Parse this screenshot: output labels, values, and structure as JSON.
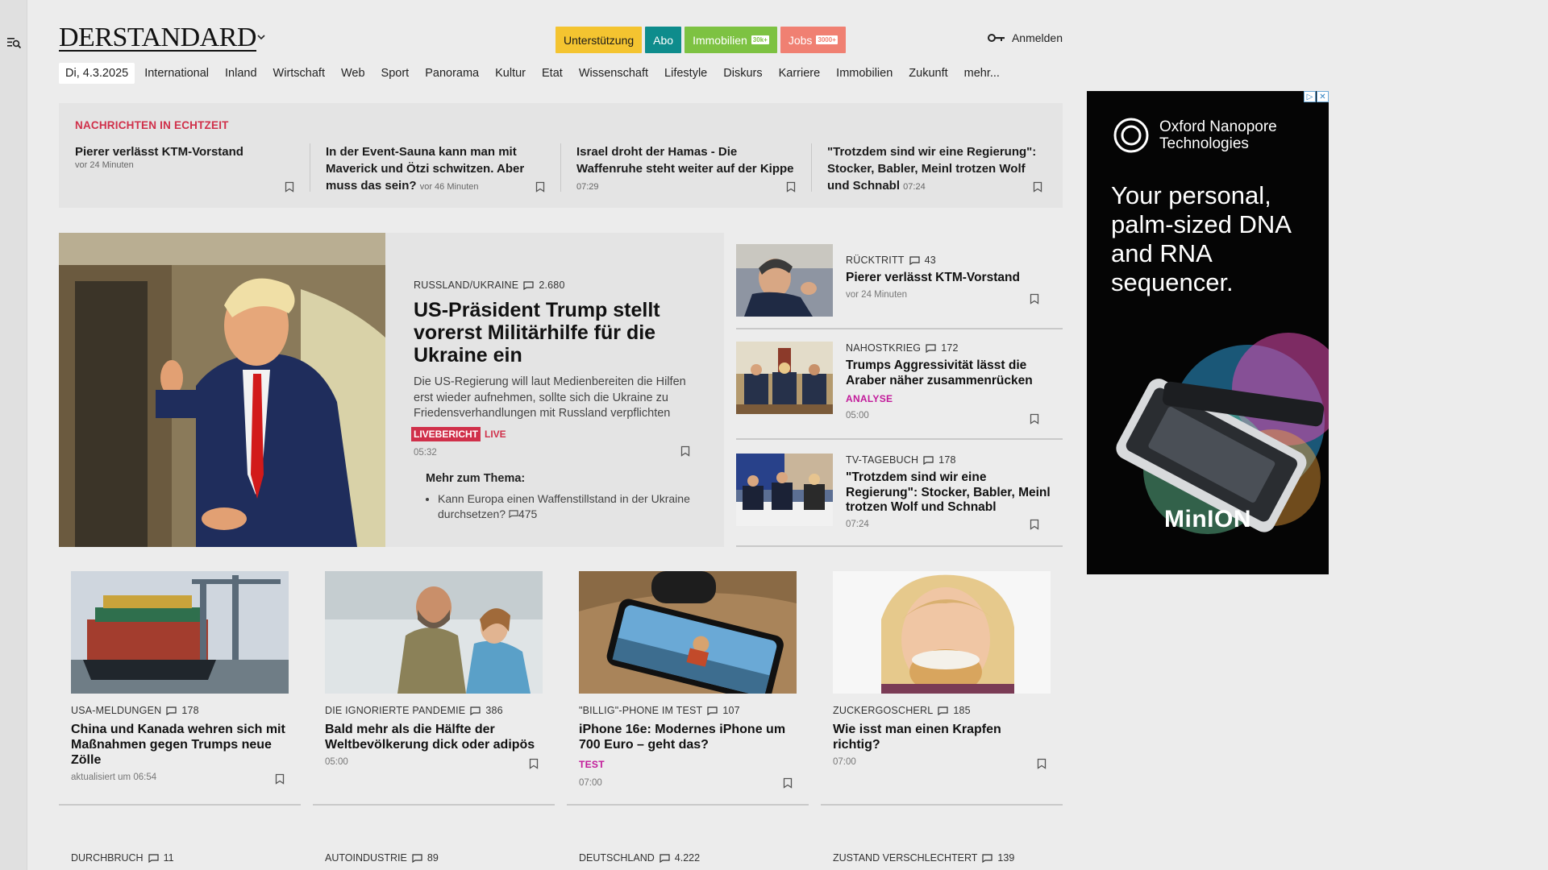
{
  "header": {
    "logo": "DERSTANDARD",
    "pills": [
      {
        "label": "Unterstützung",
        "tag": ""
      },
      {
        "label": "Abo",
        "tag": ""
      },
      {
        "label": "Immobilien",
        "tag": "30k+"
      },
      {
        "label": "Jobs",
        "tag": "3000+"
      }
    ],
    "login": "Anmelden"
  },
  "nav": {
    "date": "Di, 4.3.2025",
    "items": [
      "International",
      "Inland",
      "Wirtschaft",
      "Web",
      "Sport",
      "Panorama",
      "Kultur",
      "Etat",
      "Wissenschaft",
      "Lifestyle",
      "Diskurs",
      "Karriere",
      "Immobilien",
      "Zukunft",
      "mehr..."
    ]
  },
  "ticker": {
    "title": "NACHRICHTEN IN ECHTZEIT",
    "items": [
      {
        "title": "Pierer verlässt KTM-Vorstand",
        "time": "vor 24 Minuten"
      },
      {
        "title": "In der Event-Sauna kann man mit Maverick und Ötzi schwitzen. Aber muss das sein?",
        "time": "vor 46 Minuten"
      },
      {
        "title": "Israel droht der Hamas - Die Waffenruhe steht weiter auf der Kippe",
        "time": "07:29"
      },
      {
        "title": "\"Trotzdem sind wir eine Regierung\": Stocker, Babler, Meinl trotzen Wolf und Schnabl",
        "time": "07:24"
      }
    ]
  },
  "hero": {
    "kicker": "RUSSLAND/UKRAINE",
    "comments": "2.680",
    "title": "US-Präsident Trump stellt vorerst Militärhilfe für die Ukraine ein",
    "lead": "Die US-Regierung will laut Medienbereiten die Hilfen erst wieder aufnehmen, sollte sich die Ukraine zu Friedensverhandlungen mit Russland verpflichten",
    "badge": "LIVEBERICHT",
    "live": "LIVE",
    "time": "05:32",
    "more_title": "Mehr zum Thema:",
    "more_item": "Kann Europa einen Waffenstillstand in der Ukraine durchsetzen?",
    "more_comments": "475"
  },
  "side": [
    {
      "kicker": "RÜCKTRITT",
      "comments": "43",
      "title": "Pierer verlässt KTM-Vorstand",
      "extra": "",
      "time": "vor 24 Minuten"
    },
    {
      "kicker": "NAHOSTKRIEG",
      "comments": "172",
      "title": "Trumps Aggressivität lässt die Araber näher zusammenrücken",
      "extra": "ANALYSE",
      "time": "05:00"
    },
    {
      "kicker": "TV-TAGEBUCH",
      "comments": "178",
      "title": "\"Trotzdem sind wir eine Regierung\": Stocker, Babler, Meinl trotzen Wolf und Schnabl",
      "extra": "",
      "time": "07:24"
    }
  ],
  "cards": [
    {
      "kicker": "USA-MELDUNGEN",
      "comments": "178",
      "title": "China und Kanada wehren sich mit Maßnahmen gegen Trumps neue Zölle",
      "extra": "",
      "time": "aktualisiert um 06:54"
    },
    {
      "kicker": "DIE IGNORIERTE PANDEMIE",
      "comments": "386",
      "title": "Bald mehr als die Hälfte der Weltbevölkerung dick oder adipös",
      "extra": "",
      "time": "05:00"
    },
    {
      "kicker": "\"BILLIG\"-PHONE IM TEST",
      "comments": "107",
      "title": "iPhone 16e: Modernes iPhone um 700 Euro – geht das?",
      "extra": "TEST",
      "time": "07:00"
    },
    {
      "kicker": "ZUCKERGOSCHERL",
      "comments": "185",
      "title": "Wie isst man einen Krapfen richtig?",
      "extra": "",
      "time": "07:00"
    }
  ],
  "bottom": [
    {
      "kicker": "DURCHBRUCH",
      "comments": "11"
    },
    {
      "kicker": "AUTOINDUSTRIE",
      "comments": "89"
    },
    {
      "kicker": "DEUTSCHLAND",
      "comments": "4.222"
    },
    {
      "kicker": "ZUSTAND VERSCHLECHTERT",
      "comments": "139"
    }
  ],
  "ad": {
    "brand": "Oxford Nanopore Technologies",
    "headline": "Your personal, palm-sized DNA and RNA sequencer.",
    "product": "MinION"
  }
}
